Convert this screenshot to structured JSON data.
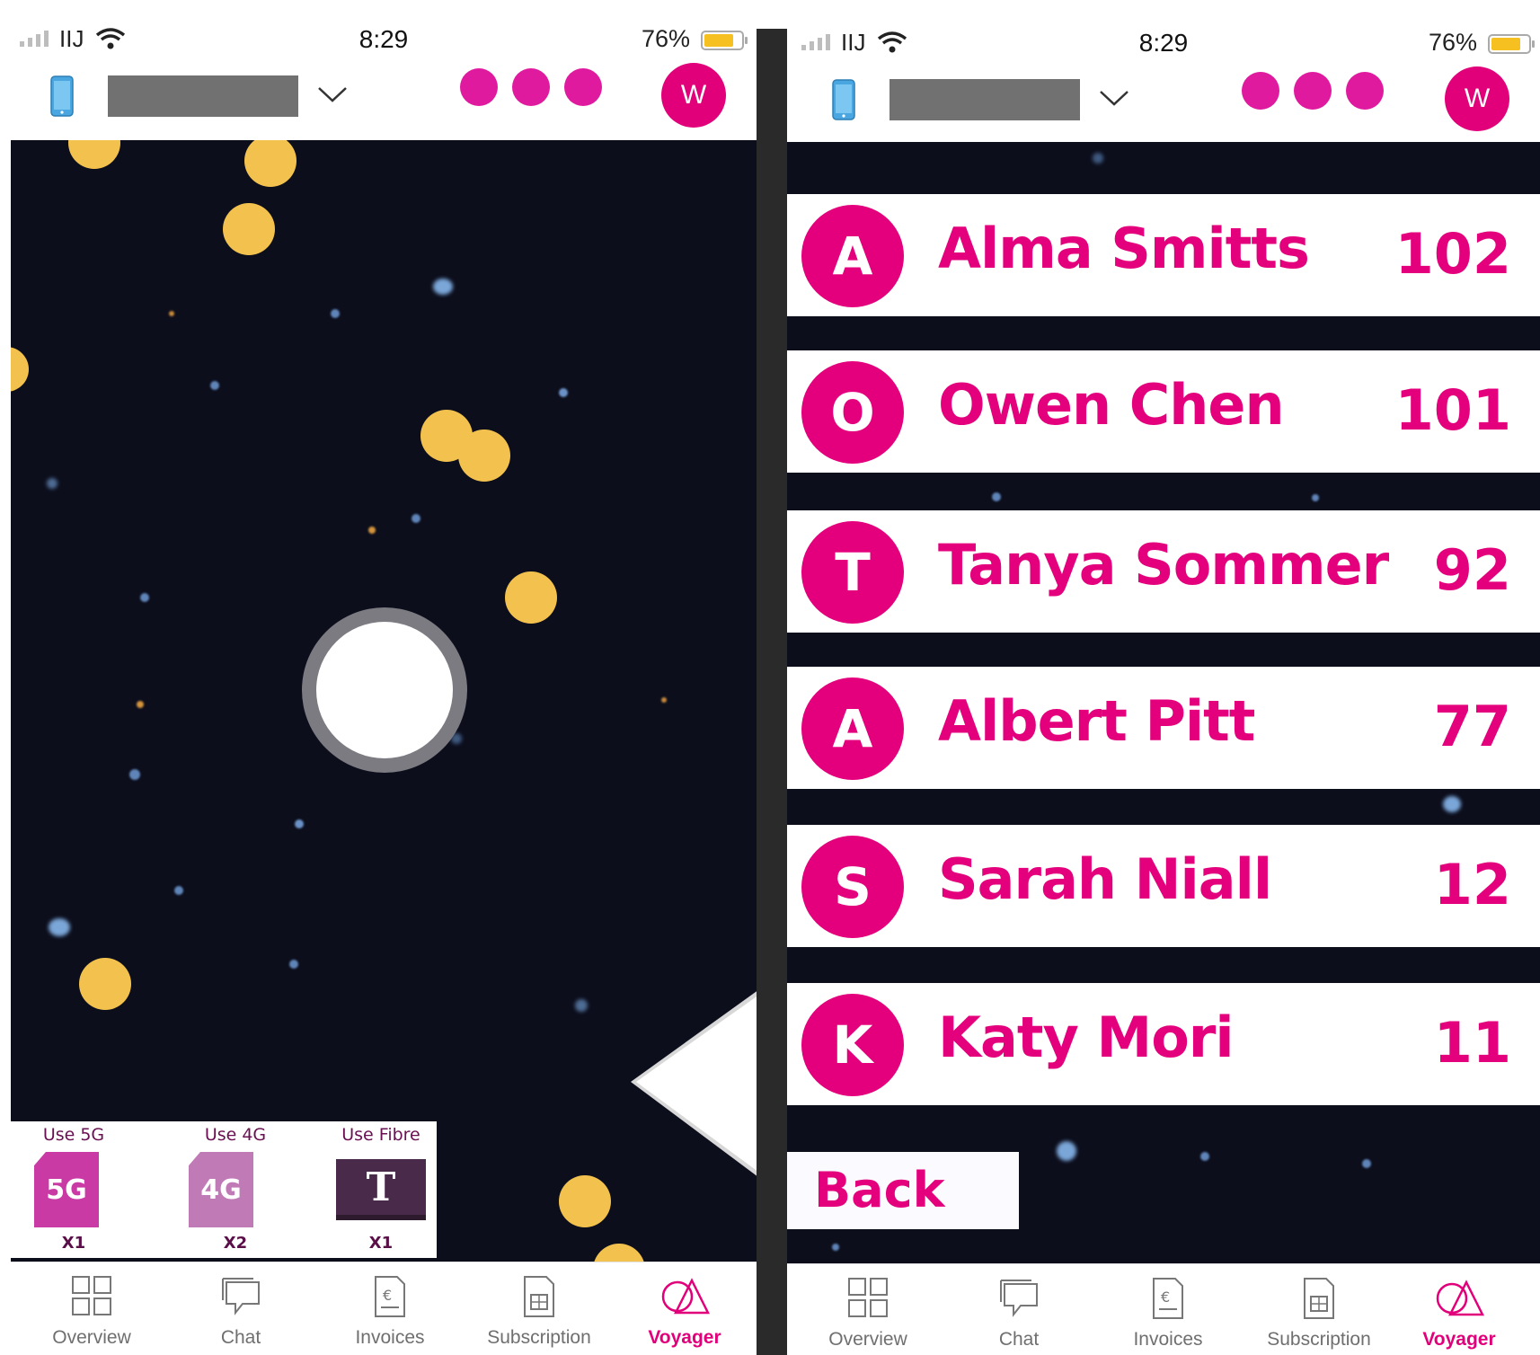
{
  "status": {
    "carrier": "IIJ",
    "time": "8:29",
    "battery": "76%",
    "battery_level": 0.76
  },
  "header": {
    "avatar_letter": "W",
    "device_icon": "smartphone-icon",
    "dropdown_icon": "chevron-down-icon"
  },
  "colors": {
    "brand": "#e2007a",
    "space": "#0c0e1c",
    "coin": "#f2c14e"
  },
  "powerups": [
    {
      "label": "Use 5G",
      "badge": "5G",
      "count": "X1",
      "color": "#c93aa5"
    },
    {
      "label": "Use 4G",
      "badge": "4G",
      "count": "X2",
      "color": "#c07ab6"
    },
    {
      "label": "Use Fibre",
      "badge": "T",
      "count": "X1",
      "color": "#4a2a4a"
    }
  ],
  "tabs": [
    {
      "label": "Overview",
      "icon": "grid-icon"
    },
    {
      "label": "Chat",
      "icon": "chat-bubble-icon"
    },
    {
      "label": "Invoices",
      "icon": "invoice-euro-icon"
    },
    {
      "label": "Subscription",
      "icon": "sim-card-icon"
    },
    {
      "label": "Voyager",
      "icon": "voyager-shapes-icon",
      "active": true
    }
  ],
  "leaderboard": [
    {
      "initial": "A",
      "name": "Alma Smitts",
      "score": "102"
    },
    {
      "initial": "O",
      "name": "Owen Chen",
      "score": "101"
    },
    {
      "initial": "T",
      "name": "Tanya Sommer",
      "score": "92"
    },
    {
      "initial": "A",
      "name": "Albert Pitt",
      "score": "77"
    },
    {
      "initial": "S",
      "name": "Sarah Niall",
      "score": "12"
    },
    {
      "initial": "K",
      "name": "Katy Mori",
      "score": "11"
    }
  ],
  "back_label": "Back"
}
